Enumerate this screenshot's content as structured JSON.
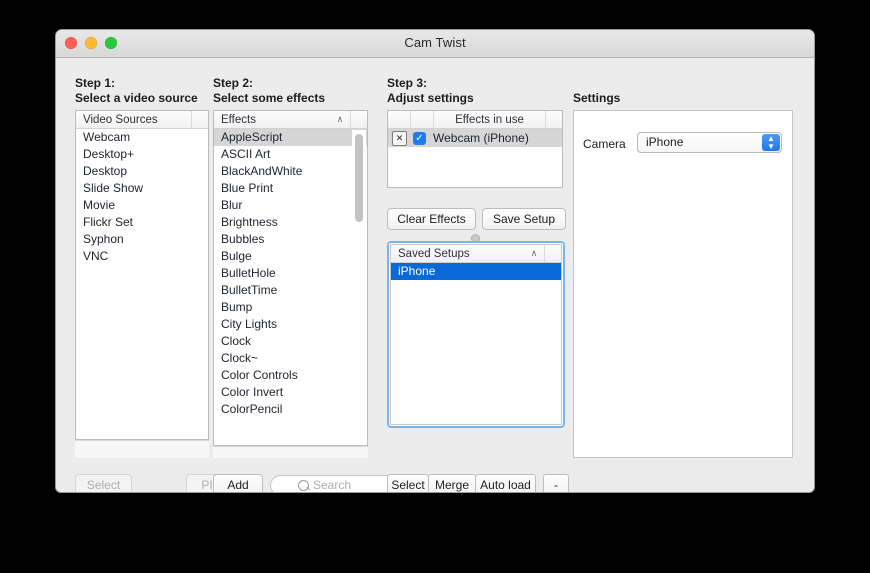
{
  "window": {
    "title": "Cam Twist",
    "traffic_lights": [
      "close-button",
      "minimize-button",
      "zoom-button"
    ]
  },
  "steps": {
    "step1": "Step 1:\nSelect a video source",
    "step2": "Step 2:\nSelect some effects",
    "step3": "Step 3:\nAdjust settings",
    "settings": "Settings"
  },
  "video_sources": {
    "header": "Video Sources",
    "items": [
      "Webcam",
      "Desktop+",
      "Desktop",
      "Slide Show",
      "Movie",
      "Flickr Set",
      "Syphon",
      "VNC"
    ],
    "selected_index": -1
  },
  "effects": {
    "header": "Effects",
    "chevron": "∧",
    "items": [
      "AppleScript",
      "ASCII Art",
      "BlackAndWhite",
      "Blue Print",
      "Blur",
      "Brightness",
      "Bubbles",
      "Bulge",
      "BulletHole",
      "BulletTime",
      "Bump",
      "City Lights",
      "Clock",
      "Clock~",
      "Color Controls",
      "Color Invert",
      "ColorPencil"
    ],
    "selected_index": 0
  },
  "effects_in_use": {
    "header": "Effects in use",
    "row": {
      "remove_label": "✕",
      "checked": true,
      "check_glyph": "✓",
      "label": "Webcam (iPhone)"
    }
  },
  "saved_setups": {
    "header": "Saved Setups",
    "chevron": "∧",
    "items": [
      "iPhone"
    ],
    "selected_index": 0
  },
  "buttons": {
    "select_source": "Select",
    "pip": "PIP",
    "add": "Add",
    "clear_effects": "Clear Effects",
    "save_setup": "Save Setup",
    "select_setup": "Select",
    "merge": "Merge",
    "auto_load": "Auto load",
    "minus": "-"
  },
  "search": {
    "placeholder": "Search",
    "value": ""
  },
  "settings": {
    "camera_label": "Camera",
    "camera_value": "iPhone",
    "stepper_up": "▲",
    "stepper_down": "▼"
  },
  "colors": {
    "selection_blue": "#0a69d8",
    "focus_ring": "#7ab4ef",
    "checkbox_blue": "#1f7ced",
    "inactive_selection": "#d6d6d6"
  }
}
